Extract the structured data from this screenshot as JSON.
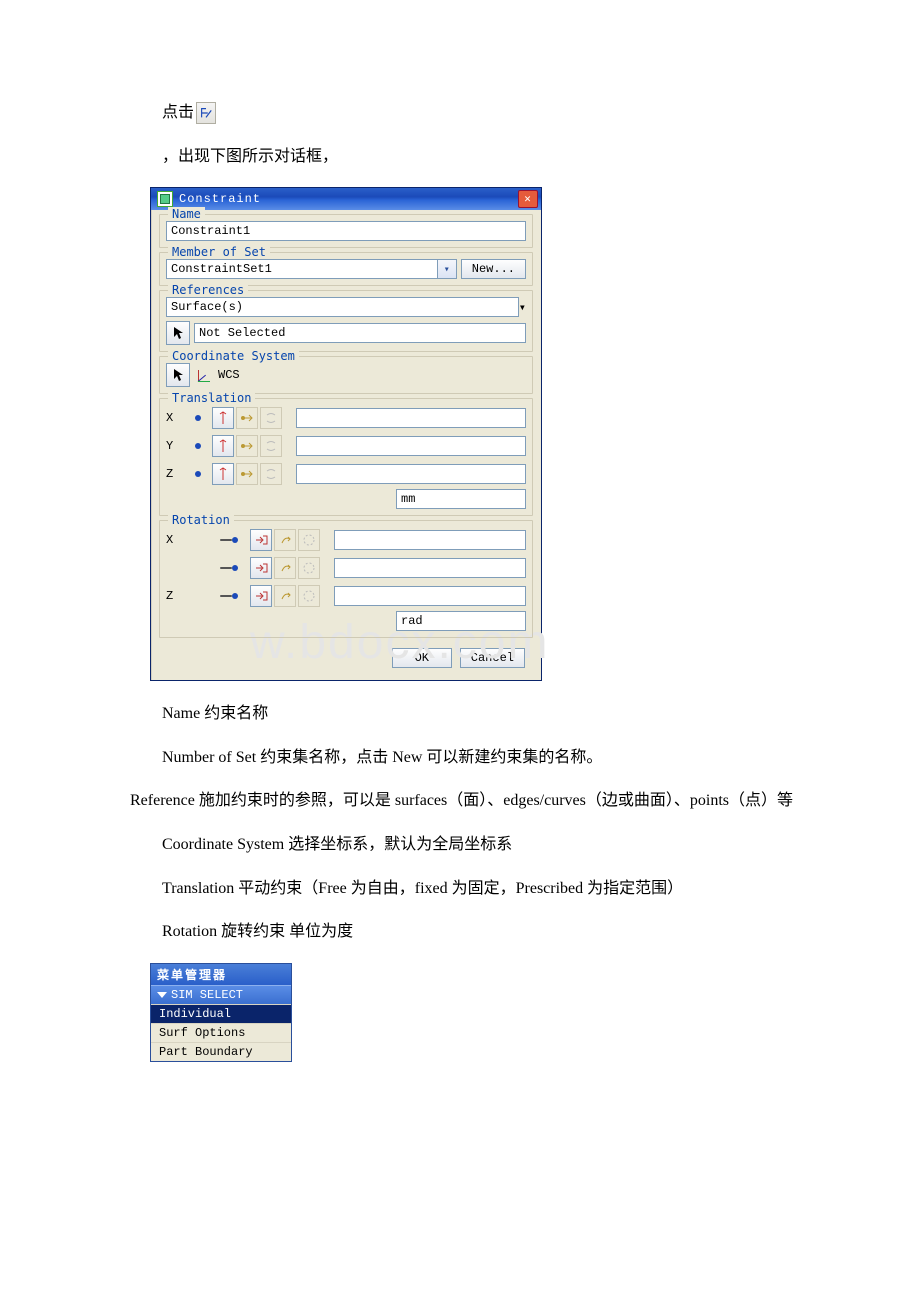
{
  "intro": {
    "click_label": "点击",
    "appear_label": "，出现下图所示对话框，"
  },
  "dialog": {
    "title": "Constraint",
    "groups": {
      "name": {
        "legend": "Name",
        "value": "Constraint1"
      },
      "member_of_set": {
        "legend": "Member of Set",
        "value": "ConstraintSet1",
        "new_btn": "New..."
      },
      "references": {
        "legend": "References",
        "type_value": "Surface(s)",
        "selection_value": "Not Selected"
      },
      "coord_system": {
        "legend": "Coordinate System",
        "value": "WCS"
      },
      "translation": {
        "legend": "Translation",
        "axes": [
          "X",
          "Y",
          "Z"
        ],
        "unit": "mm"
      },
      "rotation": {
        "legend": "Rotation",
        "axes": [
          "X",
          "",
          "Z"
        ],
        "unit": "rad"
      }
    },
    "buttons": {
      "ok": "OK",
      "cancel": "Cancel"
    }
  },
  "explain": {
    "p1": "Name 约束名称",
    "p2": "Number of Set 约束集名称，点击 New 可以新建约束集的名称。",
    "p3": "Reference 施加约束时的参照，可以是 surfaces（面）、edges/curves（边或曲面）、points（点）等",
    "p4": "Coordinate System 选择坐标系，默认为全局坐标系",
    "p5": "Translation  平动约束（Free 为自由，fixed 为固定，Prescribed 为指定范围）",
    "p6": "Rotation 旋转约束 单位为度"
  },
  "menu_manager": {
    "title": "菜单管理器",
    "section": "SIM SELECT",
    "items": [
      "Individual",
      "Surf Options",
      "Part Boundary"
    ],
    "active_index": 0
  },
  "watermark": "w.bdocx.com"
}
